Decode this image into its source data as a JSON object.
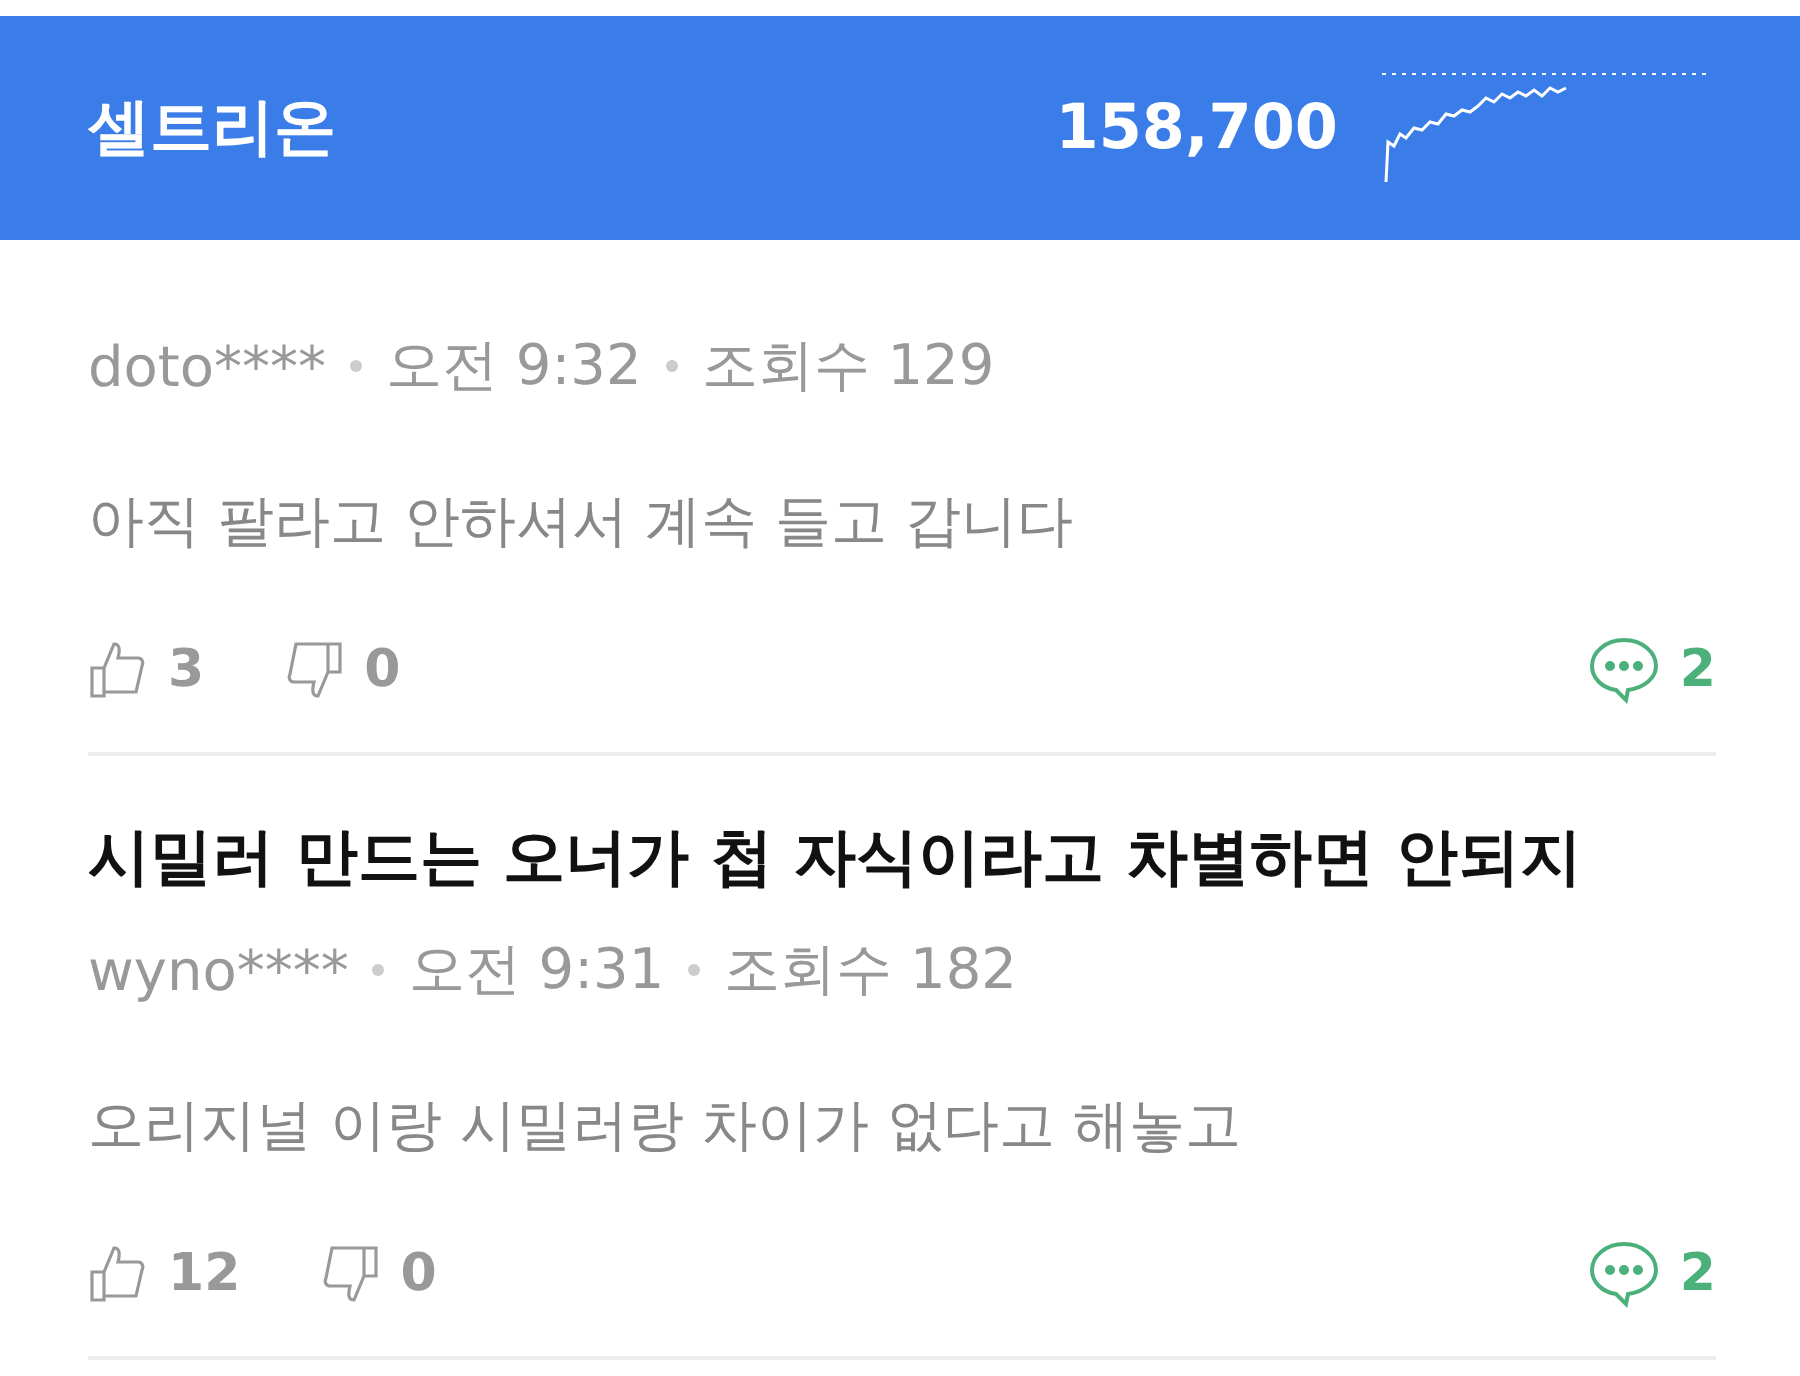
{
  "header": {
    "stock_name": "셀트리온",
    "price": "158,700"
  },
  "posts": [
    {
      "author": "doto****",
      "time": "오전 9:32",
      "views": "조회수 129",
      "body": "아직 팔라고 안하셔서 계속 들고 갑니다",
      "likes": "3",
      "dislikes": "0",
      "comments": "2"
    },
    {
      "title": "시밀러 만드는 오너가 첩 자식이라고 차별하면 안되지",
      "author": "wyno****",
      "time": "오전 9:31",
      "views": "조회수 182",
      "body": "오리지널 이랑 시밀러랑 차이가 없다고 해놓고",
      "likes": "12",
      "dislikes": "0",
      "comments": "2"
    }
  ]
}
